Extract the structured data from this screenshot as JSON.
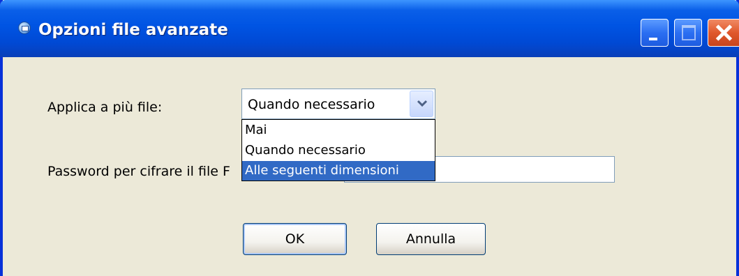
{
  "window": {
    "title": "Opzioni file avanzate",
    "title_icon": "app-icon",
    "controls": [
      "minimize-icon",
      "maximize-icon",
      "close-icon"
    ],
    "titlebar_color": "#0054e3",
    "body_color": "#ece9d8"
  },
  "form": {
    "apply_label": "Applica a più file:",
    "apply_select": {
      "selected": "Quando necessario",
      "options": [
        "Mai",
        "Quando necessario",
        "Alle seguenti dimensioni"
      ],
      "highlighted": "Alle seguenti dimensioni",
      "highlight_color": "#316ac5"
    },
    "password_label": "Password per cifrare il file F",
    "password_value": ""
  },
  "buttons": {
    "ok": "OK",
    "cancel": "Annulla"
  }
}
